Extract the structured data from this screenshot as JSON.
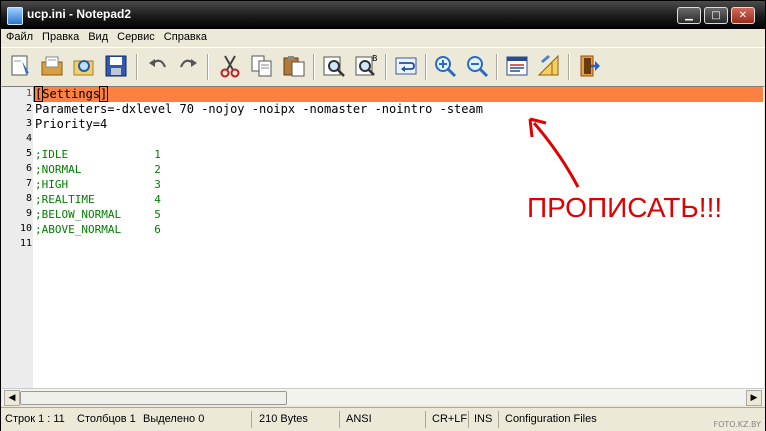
{
  "window": {
    "title": "ucp.ini - Notepad2"
  },
  "menu": [
    "Файл",
    "Правка",
    "Вид",
    "Сервис",
    "Справка"
  ],
  "toolbar": {
    "icons": [
      "new-icon",
      "open-icon",
      "browse-icon",
      "save-icon",
      "undo-icon",
      "redo-icon",
      "cut-icon",
      "copy-icon",
      "paste-icon",
      "find-icon",
      "replace-icon",
      "wordwrap-icon",
      "zoom-in-icon",
      "zoom-out-icon",
      "scheme-icon",
      "customize-icon",
      "exit-icon"
    ]
  },
  "editor": {
    "line_numbers": [
      "1",
      "2",
      "3",
      "4",
      "5",
      "6",
      "7",
      "8",
      "9",
      "10",
      "11"
    ],
    "lines": [
      {
        "text": "Settings",
        "kind": "section"
      },
      {
        "key": "Parameters",
        "eq": "=",
        "value": "-dxlevel 70 -nojoy -noipx -nomaster -nointro -steam"
      },
      {
        "key": "Priority",
        "eq": "=",
        "value": "4"
      },
      {
        "text": ""
      },
      {
        "comment": ";IDLE             1"
      },
      {
        "comment": ";NORMAL           2"
      },
      {
        "comment": ";HIGH             3"
      },
      {
        "comment": ";REALTIME         4"
      },
      {
        "comment": ";BELOW_NORMAL     5"
      },
      {
        "comment": ";ABOVE_NORMAL     6"
      },
      {
        "text": ""
      }
    ],
    "highlight_color": "#ff8040"
  },
  "annotation": {
    "text": "ПРОПИСАТЬ!!!",
    "color": "#e00000"
  },
  "status": {
    "pos": "Строк 1 : 11",
    "col": "Столбцов 1",
    "sel": "Выделено 0",
    "size": "210 Bytes",
    "enc": "ANSI",
    "eol": "CR+LF",
    "ins": "INS",
    "scheme": "Configuration Files"
  },
  "watermark": "FOTO.KZ.BY"
}
